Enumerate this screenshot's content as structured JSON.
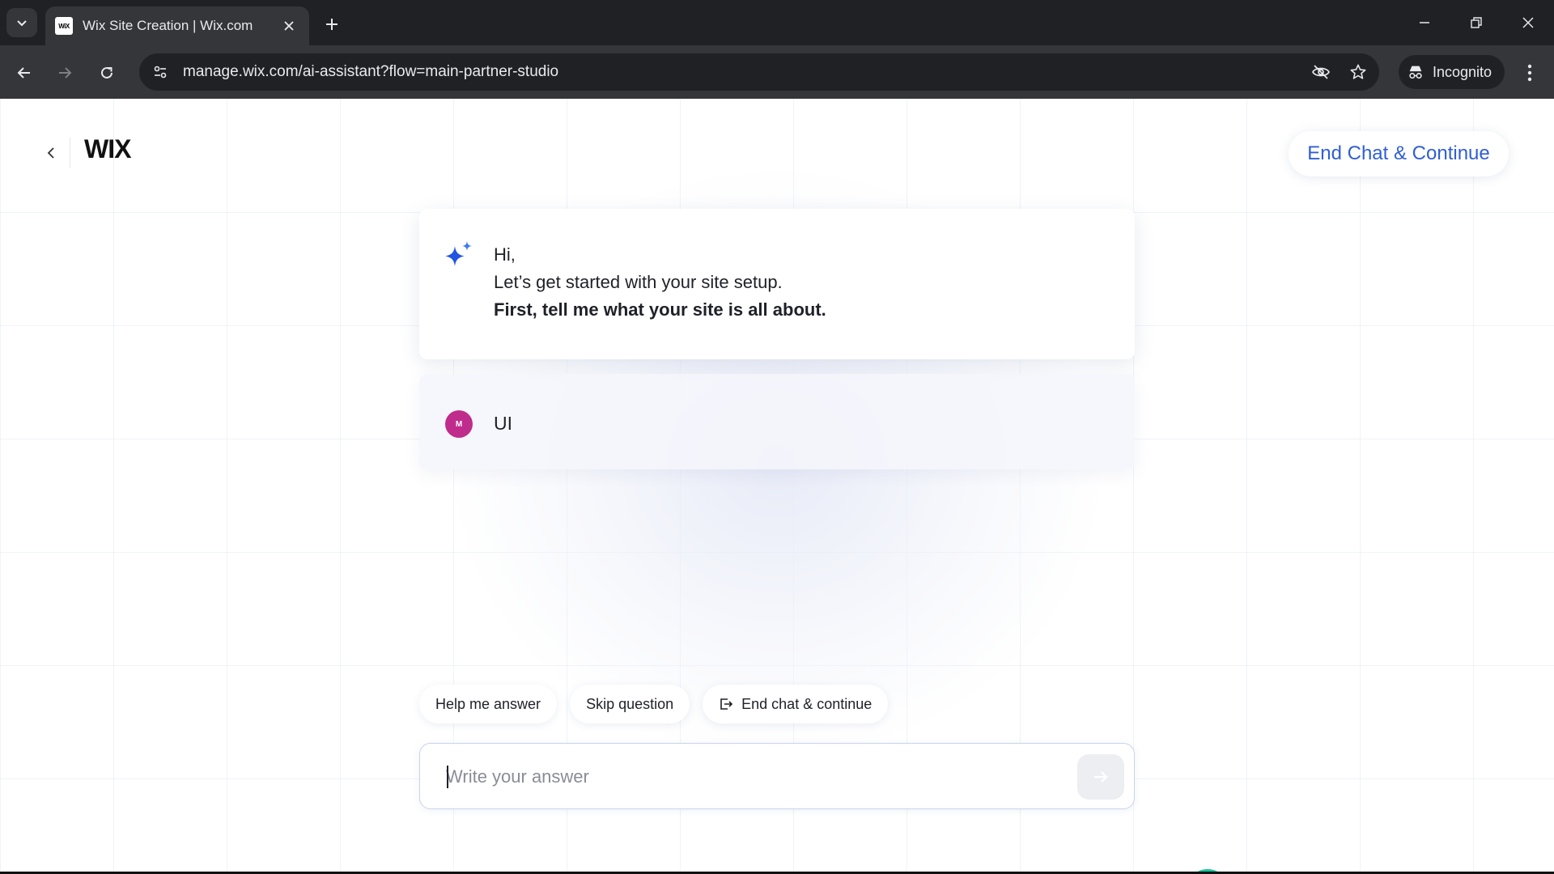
{
  "browser": {
    "tab_title": "Wix Site Creation | Wix.com",
    "favicon_text": "WiX",
    "url": "manage.wix.com/ai-assistant?flow=main-partner-studio",
    "incognito_label": "Incognito"
  },
  "header": {
    "logo_text": "WIX",
    "end_chat_label": "End Chat & Continue"
  },
  "assistant_message": {
    "greeting": "Hi,",
    "line": "Let’s get started with your site setup.",
    "question": "First, tell me what your site is all about."
  },
  "user_message": {
    "avatar_initial": "M",
    "text": "UI",
    "avatar_color": "#c02c8c"
  },
  "actions": {
    "help_label": "Help me answer",
    "skip_label": "Skip question",
    "end_label": "End chat & continue"
  },
  "answer": {
    "placeholder": "Write your answer",
    "value": ""
  },
  "colors": {
    "accent": "#2f5fd3",
    "sparkle": "#1f55e0",
    "grammarly": "#15c39a"
  }
}
